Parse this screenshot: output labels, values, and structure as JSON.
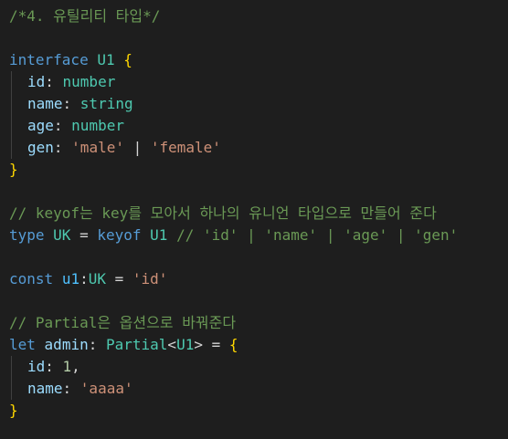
{
  "editor": {
    "lines": [
      {
        "tokens": [
          {
            "t": "/*4. 유틸리티 타입*/",
            "c": "c-comment"
          }
        ]
      },
      {
        "tokens": []
      },
      {
        "tokens": [
          {
            "t": "interface",
            "c": "c-kw"
          },
          {
            "t": " ",
            "c": "c-op"
          },
          {
            "t": "U1",
            "c": "c-type"
          },
          {
            "t": " ",
            "c": "c-op"
          },
          {
            "t": "{",
            "c": "c-brace"
          }
        ]
      },
      {
        "indent": 1,
        "tokens": [
          {
            "t": "id",
            "c": "c-prop"
          },
          {
            "t": ": ",
            "c": "c-op"
          },
          {
            "t": "number",
            "c": "c-type"
          }
        ]
      },
      {
        "indent": 1,
        "tokens": [
          {
            "t": "name",
            "c": "c-prop"
          },
          {
            "t": ": ",
            "c": "c-op"
          },
          {
            "t": "string",
            "c": "c-type"
          }
        ]
      },
      {
        "indent": 1,
        "tokens": [
          {
            "t": "age",
            "c": "c-prop"
          },
          {
            "t": ": ",
            "c": "c-op"
          },
          {
            "t": "number",
            "c": "c-type"
          }
        ]
      },
      {
        "indent": 1,
        "tokens": [
          {
            "t": "gen",
            "c": "c-prop"
          },
          {
            "t": ": ",
            "c": "c-op"
          },
          {
            "t": "'male'",
            "c": "c-str"
          },
          {
            "t": " | ",
            "c": "c-op"
          },
          {
            "t": "'female'",
            "c": "c-str"
          }
        ]
      },
      {
        "tokens": [
          {
            "t": "}",
            "c": "c-brace"
          }
        ]
      },
      {
        "tokens": []
      },
      {
        "tokens": [
          {
            "t": "// keyof는 key를 모아서 하나의 유니언 타입으로 만들어 준다",
            "c": "c-comment"
          }
        ]
      },
      {
        "tokens": [
          {
            "t": "type",
            "c": "c-kw"
          },
          {
            "t": " ",
            "c": "c-op"
          },
          {
            "t": "UK",
            "c": "c-type"
          },
          {
            "t": " = ",
            "c": "c-op"
          },
          {
            "t": "keyof",
            "c": "c-kw"
          },
          {
            "t": " ",
            "c": "c-op"
          },
          {
            "t": "U1",
            "c": "c-type"
          },
          {
            "t": " ",
            "c": "c-op"
          },
          {
            "t": "// 'id' | 'name' | 'age' | 'gen'",
            "c": "c-comment"
          }
        ]
      },
      {
        "tokens": []
      },
      {
        "tokens": [
          {
            "t": "const",
            "c": "c-kw"
          },
          {
            "t": " ",
            "c": "c-op"
          },
          {
            "t": "u1",
            "c": "c-var"
          },
          {
            "t": ":",
            "c": "c-op"
          },
          {
            "t": "UK",
            "c": "c-type"
          },
          {
            "t": " = ",
            "c": "c-op"
          },
          {
            "t": "'id'",
            "c": "c-str"
          }
        ]
      },
      {
        "tokens": []
      },
      {
        "tokens": [
          {
            "t": "// Partial은 옵션으로 바꿔준다",
            "c": "c-comment"
          }
        ]
      },
      {
        "tokens": [
          {
            "t": "let",
            "c": "c-kw"
          },
          {
            "t": " ",
            "c": "c-op"
          },
          {
            "t": "admin",
            "c": "c-prop"
          },
          {
            "t": ": ",
            "c": "c-op"
          },
          {
            "t": "Partial",
            "c": "c-type"
          },
          {
            "t": "<",
            "c": "c-op"
          },
          {
            "t": "U1",
            "c": "c-type"
          },
          {
            "t": "> = ",
            "c": "c-op"
          },
          {
            "t": "{",
            "c": "c-brace"
          }
        ]
      },
      {
        "indent": 1,
        "tokens": [
          {
            "t": "id",
            "c": "c-prop"
          },
          {
            "t": ": ",
            "c": "c-op"
          },
          {
            "t": "1",
            "c": "c-num"
          },
          {
            "t": ",",
            "c": "c-op"
          }
        ]
      },
      {
        "indent": 1,
        "tokens": [
          {
            "t": "name",
            "c": "c-prop"
          },
          {
            "t": ": ",
            "c": "c-op"
          },
          {
            "t": "'aaaa'",
            "c": "c-str"
          }
        ]
      },
      {
        "tokens": [
          {
            "t": "}",
            "c": "c-brace"
          }
        ]
      }
    ]
  },
  "colors": {
    "background": "#1e1e1e",
    "comment": "#6a9955",
    "keyword": "#569cd6",
    "type": "#4ec9b0",
    "property": "#9cdcfe",
    "string": "#ce9178",
    "number": "#b5cea8",
    "brace": "#ffd700"
  }
}
